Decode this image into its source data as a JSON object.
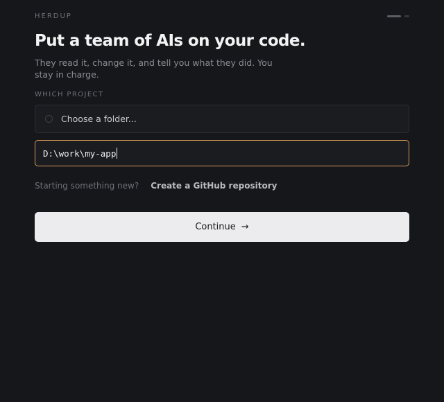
{
  "brand": "HERDUP",
  "progress": {
    "step": 1,
    "total": 2
  },
  "headline": "Put a team of AIs on your code.",
  "subhead": "They read it, change it, and tell you what they did. You stay in charge.",
  "project": {
    "section_label": "WHICH PROJECT",
    "folder_placeholder": "Choose a folder...",
    "path_value": "D:\\work\\my-app"
  },
  "new_project": {
    "prompt": "Starting something new?",
    "link": "Create a GitHub repository"
  },
  "continue": {
    "label": "Continue",
    "arrow": "→"
  },
  "colors": {
    "background": "#16171b",
    "accent_focus": "#d89a5a",
    "button_bg": "#ececee"
  }
}
